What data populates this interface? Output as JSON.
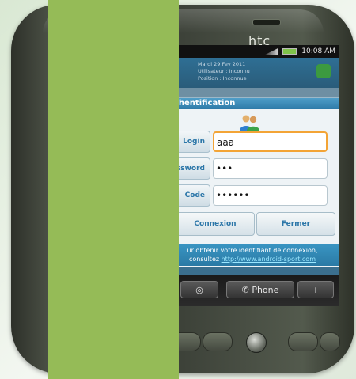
{
  "phone": {
    "brand": "htc"
  },
  "status_bar": {
    "time": "10:08 AM"
  },
  "widget": {
    "line1": "Mardi 29 Fev 2011",
    "line2": "Utilisateur : Inconnu",
    "line3": "Position : Inconnue"
  },
  "dialog": {
    "title": "uthentification",
    "fields": [
      {
        "label": "Login",
        "value": "aaa"
      },
      {
        "label": "assword",
        "value": "•••"
      },
      {
        "label": "Code",
        "value": "••••••"
      }
    ],
    "buttons": {
      "connect": "Connexion",
      "close": "Fermer"
    },
    "footer": {
      "line1": "ur obtenir votre identifiant de connexion,",
      "line2_prefix": "consultez ",
      "link": "http://www.android-sport.com"
    }
  },
  "bottom_bar": {
    "phone_label": "Phone",
    "plus_label": "+"
  },
  "colors": {
    "green_overlay": "#95bb57",
    "accent_blue": "#2b76a8",
    "active_border": "#f3a436"
  }
}
